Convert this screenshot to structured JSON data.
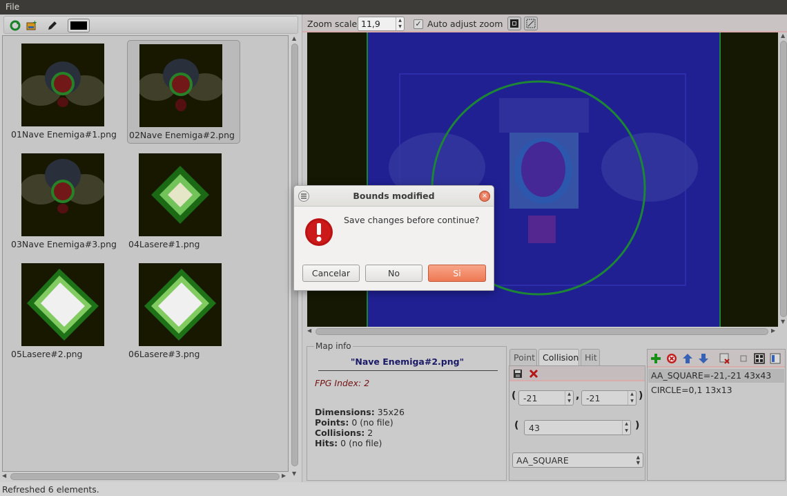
{
  "menubar": {
    "file": "File"
  },
  "left": {
    "thumbnails": [
      {
        "name": "01Nave Enemiga#1.png",
        "kind": "ship",
        "selected": false
      },
      {
        "name": "02Nave Enemiga#2.png",
        "kind": "ship",
        "selected": true
      },
      {
        "name": "03Nave Enemiga#3.png",
        "kind": "ship",
        "selected": false
      },
      {
        "name": "04Lasere#1.png",
        "kind": "laser-small",
        "selected": false
      },
      {
        "name": "05Lasere#2.png",
        "kind": "laser-big",
        "selected": false
      },
      {
        "name": "06Lasere#3.png",
        "kind": "laser-big",
        "selected": false
      }
    ],
    "toolbar_icons": [
      "refresh-icon",
      "add-image-icon",
      "pencil-icon",
      "color-swatch"
    ],
    "current_color": "#000000"
  },
  "zoom": {
    "label": "Zoom scale:",
    "value": "11,9",
    "auto_label": "Auto adjust zoom",
    "auto_checked": true
  },
  "map_info": {
    "legend": "Map info",
    "name": "\"Nave Enemiga#2.png\"",
    "fpg_index": "FPG Index: 2",
    "dimensions_label": "Dimensions:",
    "dimensions_value": " 35x26",
    "points_label": "Points:",
    "points_value": " 0 (no file)",
    "collisions_label": "Collisions:",
    "collisions_value": " 2",
    "hits_label": "Hits:",
    "hits_value": " 0 (no file)"
  },
  "tabs": [
    "Point",
    "Collision",
    "Hit"
  ],
  "active_tab": "Collision",
  "collision_editor": {
    "x": "-21",
    "y": "-21",
    "size": "43",
    "shape": "AA_SQUARE"
  },
  "collision_list": [
    "AA_SQUARE=-21,-21 43x43",
    "CIRCLE=0,1 13x13"
  ],
  "status": "Refreshed 6 elements.",
  "dialog": {
    "title": "Bounds modified",
    "message": "Save changes before continue?",
    "cancel": "Cancelar",
    "no": "No",
    "yes": "Si"
  },
  "colors": {
    "canvas_blue": "#22239d",
    "collision_circle": "#1e8f3a",
    "accent": "#ee7853"
  }
}
